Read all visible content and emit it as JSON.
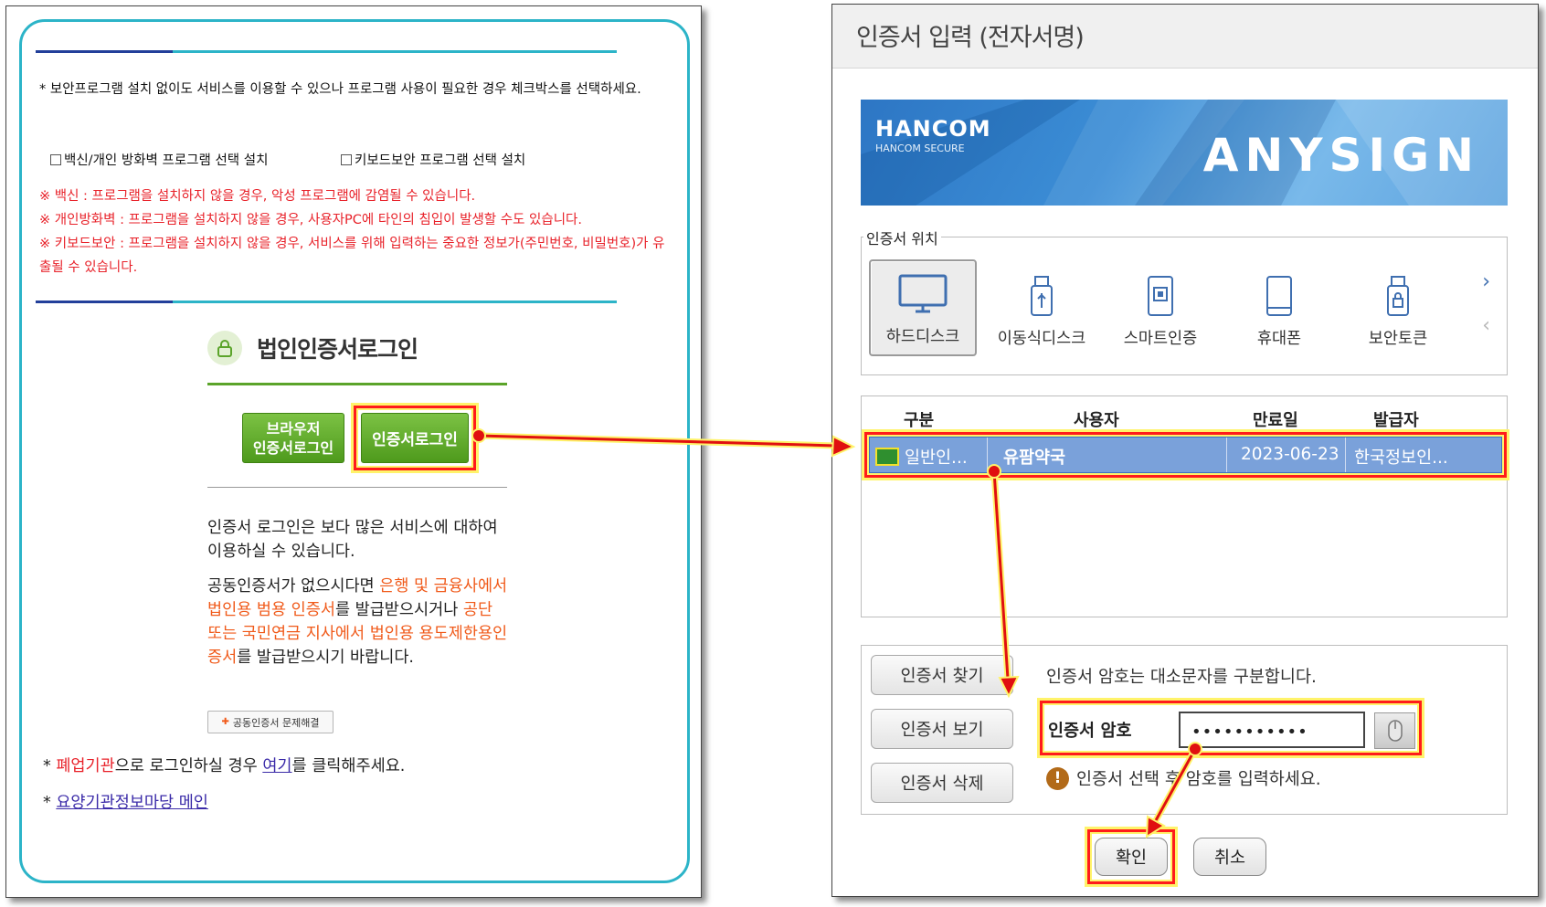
{
  "left": {
    "notice": "* 보안프로그램 설치 없이도 서비스를 이용할 수 있으나 프로그램 사용이 필요한 경우 체크박스를 선택하세요.",
    "check_vaccine": "백신/개인 방화벽 프로그램 선택 설치",
    "check_keyboard": "키보드보안 프로그램 선택 설치",
    "warn_vaccine": "※ 백신 : 프로그램을 설치하지 않을 경우, 악성 프로그램에 감염될 수 있습니다.",
    "warn_firewall": "※ 개인방화벽 : 프로그램을 설치하지 않을 경우, 사용자PC에 타인의 침입이 발생할 수도 있습니다.",
    "warn_keyboard": "※ 키보드보안 : 프로그램을 설치하지 않을 경우, 서비스를 위해 입력하는 중요한 정보가(주민번호, 비밀번호)가 유출될 수 있습니다.",
    "corp_title": "법인인증서로그인",
    "browser_login_1": "브라우저",
    "browser_login_2": "인증서로그인",
    "cert_login": "인증서로그인",
    "desc1": "인증서 로그인은 보다 많은 서비스에 대하여 이용하실 수 있습니다.",
    "desc2_a": "공동인증서가 없으시다면 ",
    "desc2_b": "은행 및 금융사에서 법인용 범용 인증서",
    "desc2_c": "를 발급받으시거나 ",
    "desc2_d": "공단 또는 국민연금 지사에서 법인용 용도제한용인증서",
    "desc2_e": "를 발급받으시기 바랍니다.",
    "trouble_btn": "공동인증서 문제해결",
    "closed_a": "* ",
    "closed_b": "폐업기관",
    "closed_c": "으로 로그인하실 경우 ",
    "closed_d": "여기",
    "closed_e": "를 클릭해주세요.",
    "main_a": "* ",
    "main_link": "요양기관정보마당 메인"
  },
  "right": {
    "title": "인증서 입력 (전자서명)",
    "brand": "HANCOM",
    "brand_sub": "HANCOM SECURE",
    "product": "ANYSIGN",
    "loc_legend": "인증서 위치",
    "locations": [
      "하드디스크",
      "이동식디스크",
      "스마트인증",
      "휴대폰",
      "보안토큰"
    ],
    "nav_next": "›",
    "nav_prev": "‹",
    "columns": [
      "구분",
      "사용자",
      "만료일",
      "발급자"
    ],
    "row": {
      "type": "일반인...",
      "user": "유팜약국",
      "expiry": "2023-06-23",
      "issuer": "한국정보인..."
    },
    "btn_find": "인증서 찾기",
    "btn_view": "인증서 보기",
    "btn_delete": "인증서 삭제",
    "hint_case": "인증서 암호는 대소문자를 구분합니다.",
    "pw_label": "인증서 암호",
    "pw_value": "•••••••••••",
    "hint_enter": "인증서 선택 후 암호를 입력하세요.",
    "ok": "확인",
    "cancel": "취소"
  },
  "colors": {
    "accent_teal": "#2cb4c8",
    "green": "#5ba42a",
    "highlight_red": "#ff1b1b",
    "highlight_yellow": "#fff36a",
    "selected_row": "#7aa1da"
  }
}
